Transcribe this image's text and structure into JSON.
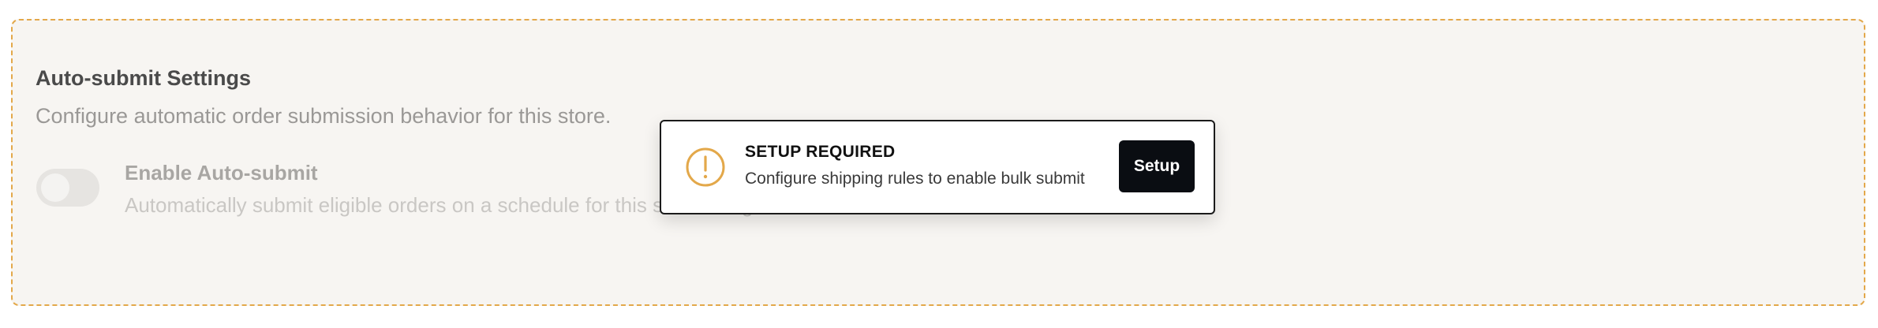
{
  "settings": {
    "title": "Auto-submit Settings",
    "subtitle": "Configure automatic order submission behavior for this store.",
    "auto_submit": {
      "label": "Enable Auto-submit",
      "description": "Automatically submit eligible orders on a schedule for this store using the selected saved card.",
      "enabled": false
    }
  },
  "alert": {
    "icon": "alert-circle-icon",
    "title": "SETUP REQUIRED",
    "message": "Configure shipping rules to enable bulk submit",
    "button_label": "Setup"
  },
  "colors": {
    "panel_border": "#e3a84a",
    "panel_bg": "#f7f5f2",
    "alert_icon": "#e3a84a",
    "button_bg": "#0a0d12"
  }
}
